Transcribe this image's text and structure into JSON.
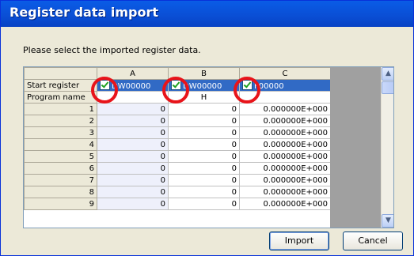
{
  "window": {
    "title": "Register data import"
  },
  "prompt": "Please select the imported register data.",
  "grid": {
    "columns": [
      "A",
      "B",
      "C"
    ],
    "start_register": {
      "label": "Start register",
      "values": [
        "DW00000",
        "DW00000",
        "F00000"
      ]
    },
    "program_name": {
      "label": "Program name",
      "values": [
        "",
        "H",
        ""
      ]
    },
    "rows": [
      {
        "index": "1",
        "a": "0",
        "b": "0",
        "c": "0.000000E+000"
      },
      {
        "index": "2",
        "a": "0",
        "b": "0",
        "c": "0.000000E+000"
      },
      {
        "index": "3",
        "a": "0",
        "b": "0",
        "c": "0.000000E+000"
      },
      {
        "index": "4",
        "a": "0",
        "b": "0",
        "c": "0.000000E+000"
      },
      {
        "index": "5",
        "a": "0",
        "b": "0",
        "c": "0.000000E+000"
      },
      {
        "index": "6",
        "a": "0",
        "b": "0",
        "c": "0.000000E+000"
      },
      {
        "index": "7",
        "a": "0",
        "b": "0",
        "c": "0.000000E+000"
      },
      {
        "index": "8",
        "a": "0",
        "b": "0",
        "c": "0.000000E+000"
      },
      {
        "index": "9",
        "a": "0",
        "b": "0",
        "c": "0.000000E+000"
      }
    ]
  },
  "buttons": {
    "import": "Import",
    "cancel": "Cancel"
  },
  "icons": {
    "checkbox": "checkbox-checked-icon",
    "scroll_up": "scroll-up-icon",
    "scroll_down": "scroll-down-icon"
  },
  "colors": {
    "title_bar": "#0a4fd6",
    "selection": "#316ac5",
    "highlight_circle": "#e8141a"
  }
}
